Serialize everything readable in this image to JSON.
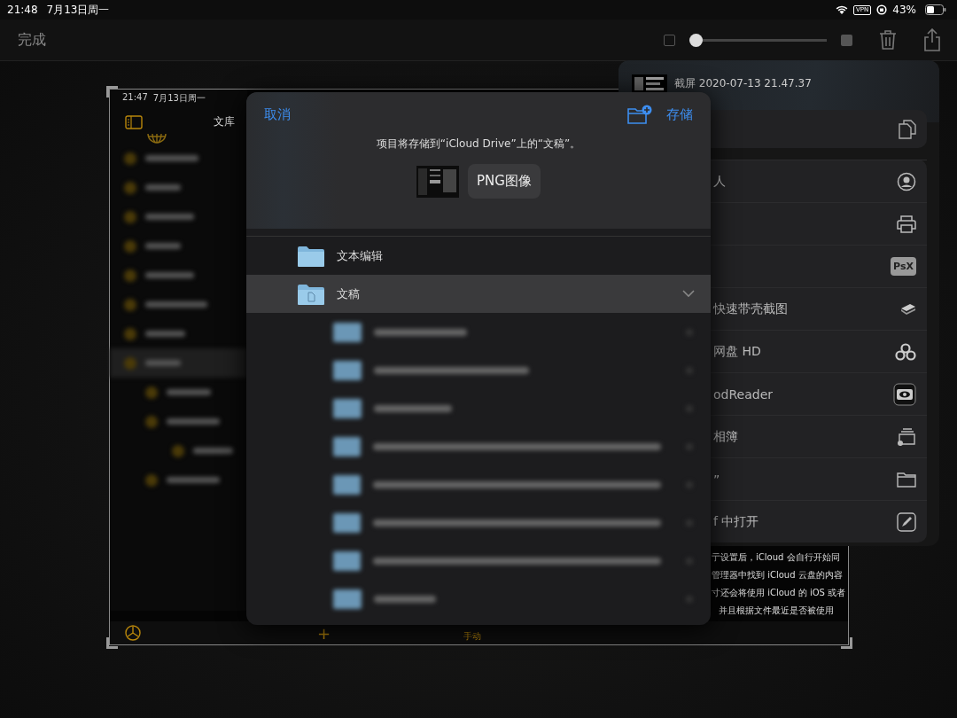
{
  "status_bar": {
    "time": "21:48",
    "date": "7月13日周一",
    "vpn": "VPN",
    "battery": "43%"
  },
  "toolbar": {
    "done": "完成",
    "opacity_slider": {
      "level": 0
    }
  },
  "preview": {
    "time": "21:47",
    "date": "7月13日周一",
    "title": "文库",
    "add": "+",
    "mode": "手动",
    "body_lines": [
      "亍设置后，iCloud 会自行开始同",
      "管理器中找到 iCloud 云盘的内容",
      "寸还会将使用 iCloud 的 iOS 或者",
      "并且根据文件最近是否被使用"
    ]
  },
  "share_sheet": {
    "title": "截屏 2020-07-13 21.47.37",
    "top_actions": [
      {
        "kind": "copy"
      }
    ],
    "actions": [
      {
        "kind": "contact",
        "label": "人"
      },
      {
        "kind": "print"
      },
      {
        "kind": "psx",
        "icon_text": "PsX"
      },
      {
        "kind": "stack",
        "label": "快速带壳截图"
      },
      {
        "kind": "cloud",
        "label": "网盘 HD"
      },
      {
        "kind": "eye",
        "label": "odReader"
      },
      {
        "kind": "album",
        "label": "相簿"
      },
      {
        "kind": "folder",
        "label": "”"
      },
      {
        "kind": "pen",
        "label": "f 中打开"
      }
    ]
  },
  "save_dialog": {
    "cancel": "取消",
    "save": "存储",
    "message": "项目将存储到“iCloud Drive”上的“文稿”。",
    "file_name": "PNG图像",
    "folders": [
      {
        "name": "文本编辑",
        "kind": "plain",
        "selected": false
      },
      {
        "name": "文稿",
        "kind": "documents",
        "selected": true,
        "expanded": true
      }
    ]
  }
}
